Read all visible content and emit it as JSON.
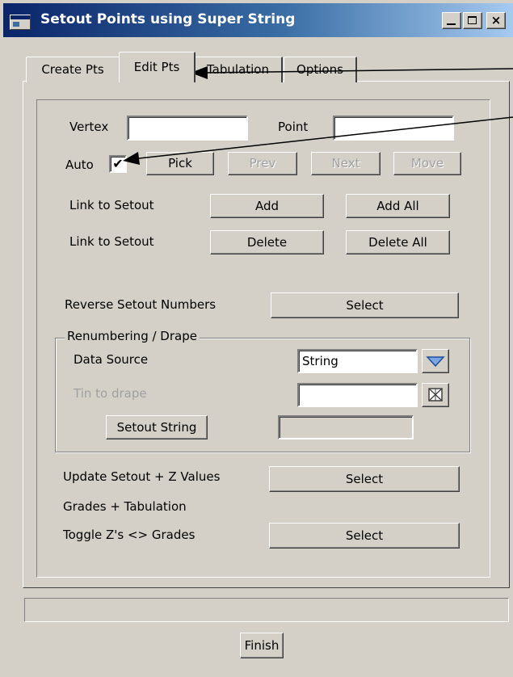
{
  "window": {
    "title": "Setout Points using Super String",
    "close_glyph": "×"
  },
  "tabs": [
    {
      "label": "Create Pts"
    },
    {
      "label": "Edit Pts"
    },
    {
      "label": "Tabulation"
    },
    {
      "label": "Options"
    }
  ],
  "edit": {
    "vertex_label": "Vertex",
    "vertex_value": "",
    "point_label": "Point",
    "point_value": "",
    "auto_label": "Auto",
    "auto_checked": "✔",
    "pick_label": "Pick",
    "prev_label": "Prev",
    "next_label": "Next",
    "move_label": "Move",
    "link_add_label": "Link to Setout",
    "add_label": "Add",
    "add_all_label": "Add All",
    "link_delete_label": "Link to Setout",
    "delete_label": "Delete",
    "delete_all_label": "Delete All",
    "reverse_label": "Reverse Setout Numbers",
    "reverse_select_label": "Select"
  },
  "renumber": {
    "legend": "Renumbering / Drape",
    "data_source_label": "Data Source",
    "data_source_value": "String",
    "tin_label": "Tin to drape",
    "tin_value": "",
    "setout_string_label": "Setout String",
    "setout_string_value": ""
  },
  "bottom": {
    "update_label": "Update Setout + Z Values",
    "update_select_label": "Select",
    "grades_label": "Grades + Tabulation",
    "toggle_label": "Toggle Z's <> Grades",
    "toggle_select_label": "Select"
  },
  "status": {
    "text": ""
  },
  "finish_label": "Finish"
}
